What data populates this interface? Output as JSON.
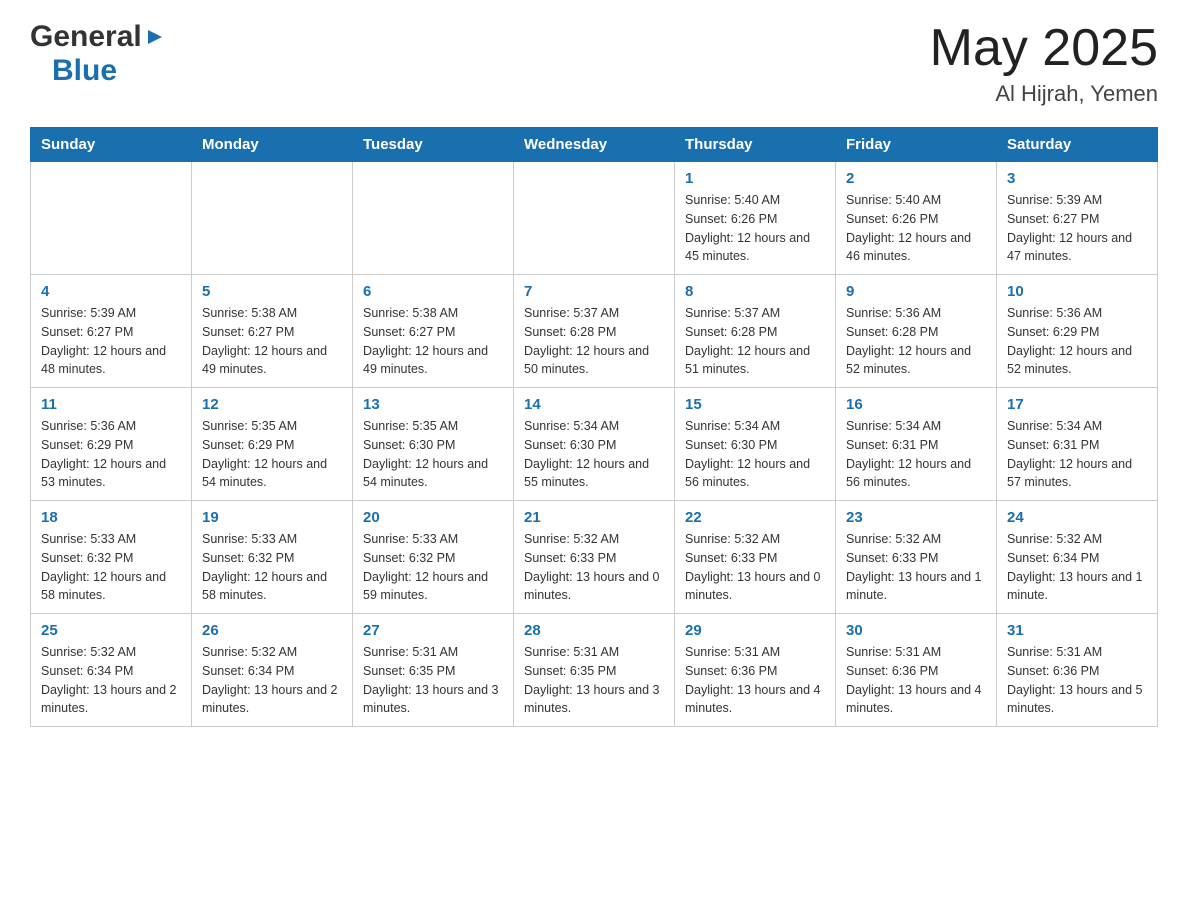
{
  "header": {
    "logo_general": "General",
    "logo_blue": "Blue",
    "month_year": "May 2025",
    "location": "Al Hijrah, Yemen"
  },
  "days_of_week": [
    "Sunday",
    "Monday",
    "Tuesday",
    "Wednesday",
    "Thursday",
    "Friday",
    "Saturday"
  ],
  "weeks": [
    [
      {
        "day": "",
        "info": ""
      },
      {
        "day": "",
        "info": ""
      },
      {
        "day": "",
        "info": ""
      },
      {
        "day": "",
        "info": ""
      },
      {
        "day": "1",
        "info": "Sunrise: 5:40 AM\nSunset: 6:26 PM\nDaylight: 12 hours and 45 minutes."
      },
      {
        "day": "2",
        "info": "Sunrise: 5:40 AM\nSunset: 6:26 PM\nDaylight: 12 hours and 46 minutes."
      },
      {
        "day": "3",
        "info": "Sunrise: 5:39 AM\nSunset: 6:27 PM\nDaylight: 12 hours and 47 minutes."
      }
    ],
    [
      {
        "day": "4",
        "info": "Sunrise: 5:39 AM\nSunset: 6:27 PM\nDaylight: 12 hours and 48 minutes."
      },
      {
        "day": "5",
        "info": "Sunrise: 5:38 AM\nSunset: 6:27 PM\nDaylight: 12 hours and 49 minutes."
      },
      {
        "day": "6",
        "info": "Sunrise: 5:38 AM\nSunset: 6:27 PM\nDaylight: 12 hours and 49 minutes."
      },
      {
        "day": "7",
        "info": "Sunrise: 5:37 AM\nSunset: 6:28 PM\nDaylight: 12 hours and 50 minutes."
      },
      {
        "day": "8",
        "info": "Sunrise: 5:37 AM\nSunset: 6:28 PM\nDaylight: 12 hours and 51 minutes."
      },
      {
        "day": "9",
        "info": "Sunrise: 5:36 AM\nSunset: 6:28 PM\nDaylight: 12 hours and 52 minutes."
      },
      {
        "day": "10",
        "info": "Sunrise: 5:36 AM\nSunset: 6:29 PM\nDaylight: 12 hours and 52 minutes."
      }
    ],
    [
      {
        "day": "11",
        "info": "Sunrise: 5:36 AM\nSunset: 6:29 PM\nDaylight: 12 hours and 53 minutes."
      },
      {
        "day": "12",
        "info": "Sunrise: 5:35 AM\nSunset: 6:29 PM\nDaylight: 12 hours and 54 minutes."
      },
      {
        "day": "13",
        "info": "Sunrise: 5:35 AM\nSunset: 6:30 PM\nDaylight: 12 hours and 54 minutes."
      },
      {
        "day": "14",
        "info": "Sunrise: 5:34 AM\nSunset: 6:30 PM\nDaylight: 12 hours and 55 minutes."
      },
      {
        "day": "15",
        "info": "Sunrise: 5:34 AM\nSunset: 6:30 PM\nDaylight: 12 hours and 56 minutes."
      },
      {
        "day": "16",
        "info": "Sunrise: 5:34 AM\nSunset: 6:31 PM\nDaylight: 12 hours and 56 minutes."
      },
      {
        "day": "17",
        "info": "Sunrise: 5:34 AM\nSunset: 6:31 PM\nDaylight: 12 hours and 57 minutes."
      }
    ],
    [
      {
        "day": "18",
        "info": "Sunrise: 5:33 AM\nSunset: 6:32 PM\nDaylight: 12 hours and 58 minutes."
      },
      {
        "day": "19",
        "info": "Sunrise: 5:33 AM\nSunset: 6:32 PM\nDaylight: 12 hours and 58 minutes."
      },
      {
        "day": "20",
        "info": "Sunrise: 5:33 AM\nSunset: 6:32 PM\nDaylight: 12 hours and 59 minutes."
      },
      {
        "day": "21",
        "info": "Sunrise: 5:32 AM\nSunset: 6:33 PM\nDaylight: 13 hours and 0 minutes."
      },
      {
        "day": "22",
        "info": "Sunrise: 5:32 AM\nSunset: 6:33 PM\nDaylight: 13 hours and 0 minutes."
      },
      {
        "day": "23",
        "info": "Sunrise: 5:32 AM\nSunset: 6:33 PM\nDaylight: 13 hours and 1 minute."
      },
      {
        "day": "24",
        "info": "Sunrise: 5:32 AM\nSunset: 6:34 PM\nDaylight: 13 hours and 1 minute."
      }
    ],
    [
      {
        "day": "25",
        "info": "Sunrise: 5:32 AM\nSunset: 6:34 PM\nDaylight: 13 hours and 2 minutes."
      },
      {
        "day": "26",
        "info": "Sunrise: 5:32 AM\nSunset: 6:34 PM\nDaylight: 13 hours and 2 minutes."
      },
      {
        "day": "27",
        "info": "Sunrise: 5:31 AM\nSunset: 6:35 PM\nDaylight: 13 hours and 3 minutes."
      },
      {
        "day": "28",
        "info": "Sunrise: 5:31 AM\nSunset: 6:35 PM\nDaylight: 13 hours and 3 minutes."
      },
      {
        "day": "29",
        "info": "Sunrise: 5:31 AM\nSunset: 6:36 PM\nDaylight: 13 hours and 4 minutes."
      },
      {
        "day": "30",
        "info": "Sunrise: 5:31 AM\nSunset: 6:36 PM\nDaylight: 13 hours and 4 minutes."
      },
      {
        "day": "31",
        "info": "Sunrise: 5:31 AM\nSunset: 6:36 PM\nDaylight: 13 hours and 5 minutes."
      }
    ]
  ]
}
